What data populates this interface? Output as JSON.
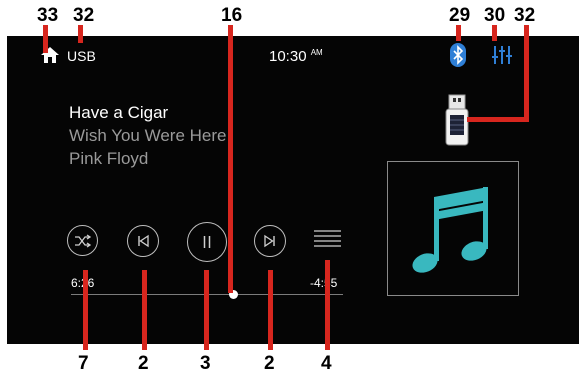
{
  "callouts": {
    "top": [
      "33",
      "32",
      "16",
      "29",
      "30",
      "32"
    ],
    "bottom": [
      "7",
      "2",
      "3",
      "2",
      "4"
    ]
  },
  "status_bar": {
    "source_label": "USB",
    "clock_time": "10:30",
    "clock_ampm": "AM",
    "home_icon": "home-icon",
    "bluetooth_icon": "bluetooth-icon",
    "eq_icon": "equalizer-icon",
    "accent_color": "#2f7fd6"
  },
  "track": {
    "title": "Have a Cigar",
    "album": "Wish You Were Here",
    "artist": "Pink Floyd"
  },
  "progress": {
    "elapsed": "6:26",
    "remaining": "-4:55"
  },
  "controls": {
    "shuffle_icon": "shuffle-icon",
    "prev_icon": "skip-previous-icon",
    "pause_icon": "pause-icon",
    "next_icon": "skip-next-icon",
    "list_icon": "list-icon"
  },
  "media": {
    "usb_device_icon": "usb-drive-icon",
    "album_art_icon": "music-note-icon",
    "album_art_color": "#39b8bf"
  },
  "colors": {
    "callout_line": "#d7261e",
    "screen_bg": "#050505"
  }
}
